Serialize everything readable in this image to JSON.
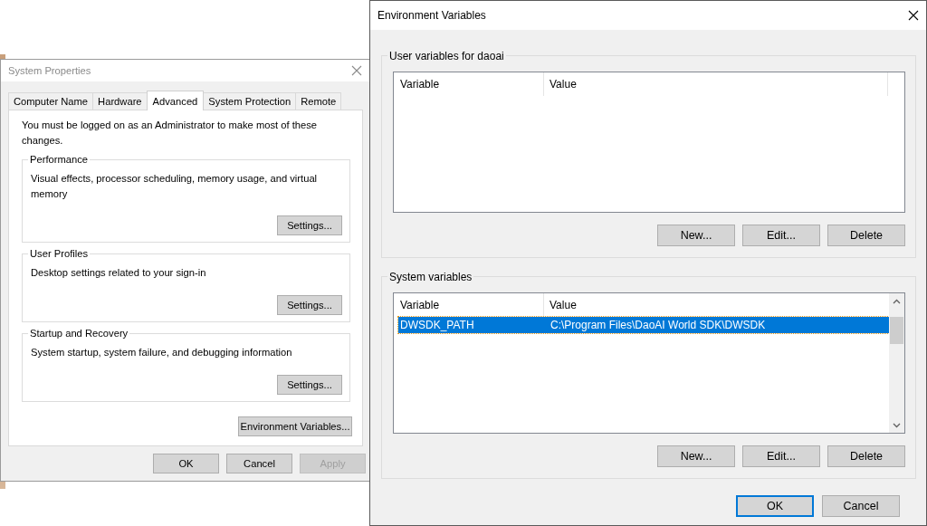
{
  "system_properties": {
    "title": "System Properties",
    "active": false,
    "tabs": [
      {
        "label": "Computer Name",
        "selected": false
      },
      {
        "label": "Hardware",
        "selected": false
      },
      {
        "label": "Advanced",
        "selected": true
      },
      {
        "label": "System Protection",
        "selected": false
      },
      {
        "label": "Remote",
        "selected": false
      }
    ],
    "notice": "You must be logged on as an Administrator to make most of these changes.",
    "groups": [
      {
        "title": "Performance",
        "description": "Visual effects, processor scheduling, memory usage, and virtual memory",
        "button": "Settings..."
      },
      {
        "title": "User Profiles",
        "description": "Desktop settings related to your sign-in",
        "button": "Settings..."
      },
      {
        "title": "Startup and Recovery",
        "description": "System startup, system failure, and debugging information",
        "button": "Settings..."
      }
    ],
    "environment_button": "Environment Variables...",
    "buttons": [
      {
        "label": "OK",
        "disabled": false
      },
      {
        "label": "Cancel",
        "disabled": false
      },
      {
        "label": "Apply",
        "disabled": true
      }
    ]
  },
  "environment_variables": {
    "title": "Environment Variables",
    "active": true,
    "sections": [
      {
        "title": "User variables for daoai",
        "columns": [
          "Variable",
          "Value"
        ],
        "scrollbar": false,
        "buttons": [
          "New...",
          "Edit...",
          "Delete"
        ]
      },
      {
        "title": "System variables",
        "columns": [
          "Variable",
          "Value"
        ],
        "scrollbar": true,
        "rows": [
          {
            "variable": "DWSDK_PATH",
            "value": "C:\\Program Files\\DaoAI World SDK\\DWSDK",
            "selected": true
          }
        ],
        "buttons": [
          "New...",
          "Edit...",
          "Delete"
        ]
      }
    ],
    "buttons": [
      {
        "label": "OK",
        "default": true
      },
      {
        "label": "Cancel",
        "default": false
      }
    ]
  }
}
